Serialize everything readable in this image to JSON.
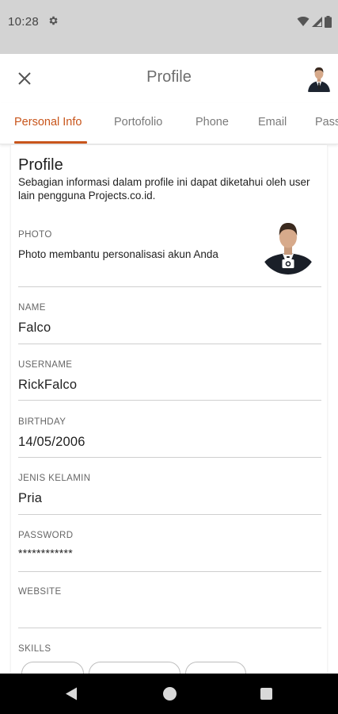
{
  "status_bar": {
    "time": "10:28",
    "icons": [
      "gear-icon",
      "wifi-icon",
      "cellular-signal-icon",
      "battery-icon"
    ]
  },
  "app_bar": {
    "title": "Profile",
    "close_icon": "close-icon",
    "avatar": "user-avatar"
  },
  "tabs": [
    {
      "label": "Personal Info",
      "active": true
    },
    {
      "label": "Portofolio",
      "active": false
    },
    {
      "label": "Phone",
      "active": false
    },
    {
      "label": "Email",
      "active": false
    },
    {
      "label": "Pass",
      "active": false
    }
  ],
  "profile": {
    "title": "Profile",
    "description": "Sebagian informasi dalam profile ini dapat diketahui oleh user lain pengguna Projects.co.id.",
    "photo": {
      "label": "PHOTO",
      "description": "Photo membantu personalisasi akun Anda",
      "icon": "camera-icon"
    },
    "fields": [
      {
        "label": "NAME",
        "value": "Falco"
      },
      {
        "label": "USERNAME",
        "value": "RickFalco"
      },
      {
        "label": "BIRTHDAY",
        "value": "14/05/2006"
      },
      {
        "label": "JENIS KELAMIN",
        "value": "Pria"
      },
      {
        "label": "PASSWORD",
        "value": "************"
      },
      {
        "label": "WEBSITE",
        "value": ""
      }
    ],
    "skills_label": "SKILLS"
  },
  "colors": {
    "accent": "#c8551b",
    "status_bar_bg": "#d3d3d3",
    "nav_bar_bg": "#000000"
  },
  "nav_bar": {
    "icons": [
      "back-icon",
      "home-icon",
      "recent-apps-icon"
    ]
  }
}
